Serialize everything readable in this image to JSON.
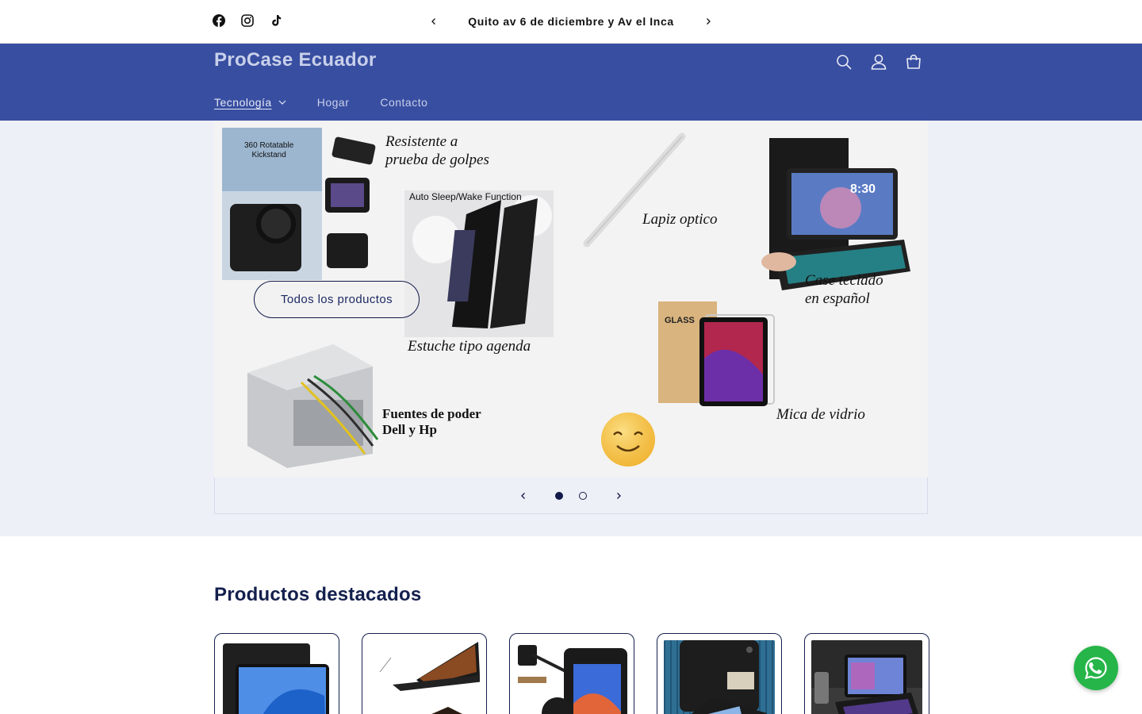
{
  "announcement": {
    "text": "Quito av 6 de diciembre y Av el Inca",
    "prev_icon": "chevron-left-icon",
    "next_icon": "chevron-right-icon"
  },
  "social": [
    "facebook-icon",
    "instagram-icon",
    "tiktok-icon"
  ],
  "header": {
    "logo": "ProCase Ecuador",
    "icons": [
      "search-icon",
      "account-icon",
      "cart-icon"
    ],
    "nav": [
      {
        "label": "Tecnología",
        "active": true,
        "has_dropdown": true
      },
      {
        "label": "Hogar",
        "active": false,
        "has_dropdown": false
      },
      {
        "label": "Contacto",
        "active": false,
        "has_dropdown": false
      }
    ]
  },
  "hero": {
    "captions": {
      "resistente": "Resistente a\nprueba de golpes",
      "kickstand": "360 Rotatable\nKickstand",
      "sleep": "Auto Sleep/Wake Function",
      "lapiz": "Lapiz optico",
      "teclado": "Case teclado\nen español",
      "agenda": "Estuche tipo agenda",
      "fuentes": "Fuentes de poder\nDell y Hp",
      "mica": "Mica de vidrio",
      "clock": "8:30",
      "glass": "GLASS"
    },
    "cta_label": "Todos los productos",
    "slides_total": 2,
    "active_slide": 1
  },
  "featured": {
    "title": "Productos destacados",
    "product_count": 5
  },
  "colors": {
    "header_bg": "#384ea1",
    "hero_bg": "#eef0f7",
    "accent_dark": "#121a4a",
    "whatsapp": "#25b548"
  }
}
